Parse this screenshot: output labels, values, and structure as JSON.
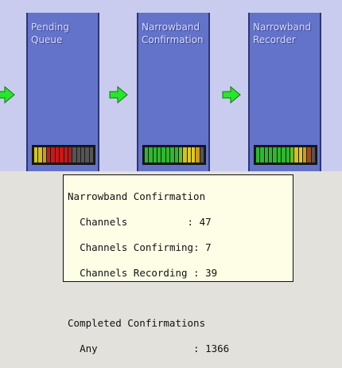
{
  "stages": [
    {
      "title_lines": [
        "Pending",
        "Queue"
      ]
    },
    {
      "title_lines": [
        "Narrowband",
        "Confirmation"
      ]
    },
    {
      "title_lines": [
        "Narrowband",
        "Recorder"
      ]
    }
  ],
  "colors": {
    "stage_fill": "#6373c9",
    "background": "#c9ccef",
    "arrow": "#29e62b",
    "tooltip_bg": "#fefee6"
  },
  "tooltip": {
    "section1_title": "Narrowband Confirmation",
    "channels_label": "Channels",
    "channels_value": "47",
    "confirming_label": "Channels Confirming",
    "confirming_value": "7",
    "recording_label": "Channels Recording",
    "recording_value": "39",
    "section2_title": "Completed Confirmations",
    "any_label": "Any",
    "any_value": "1366"
  },
  "icons": [
    "arrow-right-icon",
    "level-meter"
  ]
}
